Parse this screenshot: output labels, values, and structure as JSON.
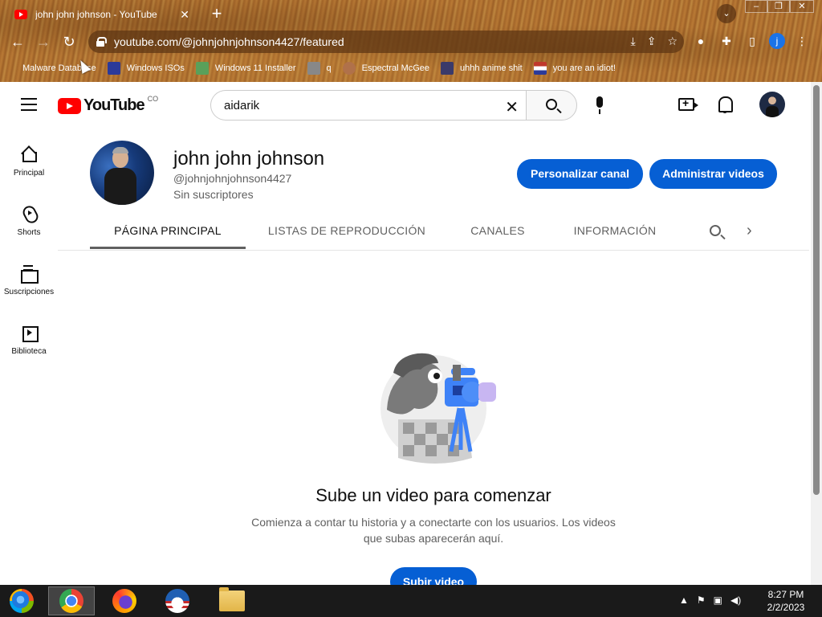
{
  "browser": {
    "tab": {
      "title": "john john johnson - YouTube"
    },
    "address": "youtube.com/@johnjohnjohnson4427/featured",
    "profile_initial": "j",
    "bookmarks": [
      {
        "label": "Malware Database",
        "color": "#4a4a4a"
      },
      {
        "label": "Windows ISOs",
        "color": "#2b3a9a"
      },
      {
        "label": "Windows 11 Installer",
        "color": "#5aa05a"
      },
      {
        "label": "q",
        "color": "#888888"
      },
      {
        "label": "Espectral McGee",
        "color": "#b0714a"
      },
      {
        "label": "uhhh anime shit",
        "color": "#3a3a6a"
      },
      {
        "label": "you are an idiot!",
        "color": "#c0392b"
      }
    ]
  },
  "youtube": {
    "logo_text": "YouTube",
    "country_code": "CO",
    "search": {
      "value": "aidarik"
    },
    "guide": [
      {
        "label": "Principal"
      },
      {
        "label": "Shorts"
      },
      {
        "label": "Suscripciones"
      },
      {
        "label": "Biblioteca"
      }
    ],
    "channel": {
      "name": "john john johnson",
      "handle": "@johnjohnjohnson4427",
      "subscribers": "Sin suscriptores",
      "customize_label": "Personalizar canal",
      "manage_label": "Administrar videos"
    },
    "tabs": [
      {
        "label": "PÁGINA PRINCIPAL",
        "active": true
      },
      {
        "label": "LISTAS DE REPRODUCCIÓN",
        "active": false
      },
      {
        "label": "CANALES",
        "active": false
      },
      {
        "label": "INFORMACIÓN",
        "active": false
      }
    ],
    "empty_state": {
      "title": "Sube un video para comenzar",
      "description": "Comienza a contar tu historia y a conectarte con los usuarios. Los videos que subas aparecerán aquí.",
      "upload_label": "Subir video"
    }
  },
  "taskbar": {
    "time": "8:27 PM",
    "date": "2/2/2023"
  },
  "colors": {
    "accent_blue": "#065fd4",
    "youtube_red": "#ff0000"
  }
}
